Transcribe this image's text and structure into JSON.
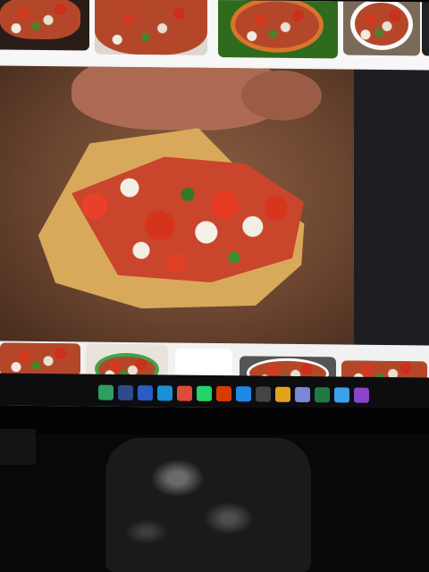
{
  "top_thumbnails": [
    {
      "name": "salsa-thumb-1"
    },
    {
      "name": "salsa-thumb-2"
    },
    {
      "name": "salsa-thumb-3"
    },
    {
      "name": "salsa-thumb-4"
    }
  ],
  "preview": {
    "name": "main-preview-image"
  },
  "bottom_thumbnails": [
    {
      "name": "salsa-thumb-5"
    },
    {
      "name": "salsa-thumb-6"
    },
    {
      "name": "salsa-thumb-7"
    },
    {
      "name": "salsa-thumb-8"
    },
    {
      "name": "salsa-thumb-9"
    }
  ],
  "taskbar": {
    "icons": [
      {
        "icon": "store-icon",
        "color": "#2e9e63"
      },
      {
        "icon": "file-icon",
        "color": "#2b4b8a"
      },
      {
        "icon": "word-icon",
        "color": "#2b5cc4"
      },
      {
        "icon": "mail-icon",
        "color": "#1d8fd6"
      },
      {
        "icon": "chrome-icon",
        "color": "#dd4b39"
      },
      {
        "icon": "whatsapp-icon",
        "color": "#25d366"
      },
      {
        "icon": "photos-icon",
        "color": "#d83b01"
      },
      {
        "icon": "settings-icon",
        "color": "#1e88e5"
      },
      {
        "icon": "app-icon",
        "color": "#444444"
      },
      {
        "icon": "folder-icon",
        "color": "#e3a21a"
      },
      {
        "icon": "teams-icon",
        "color": "#7a86d6"
      },
      {
        "icon": "excel-icon",
        "color": "#1e7a43"
      },
      {
        "icon": "wifi-icon",
        "color": "#3aa0e8"
      },
      {
        "icon": "media-icon",
        "color": "#8a43c9"
      }
    ]
  },
  "colors": {
    "accent": "#d6331c",
    "taskbar": "#0d0d0f"
  }
}
